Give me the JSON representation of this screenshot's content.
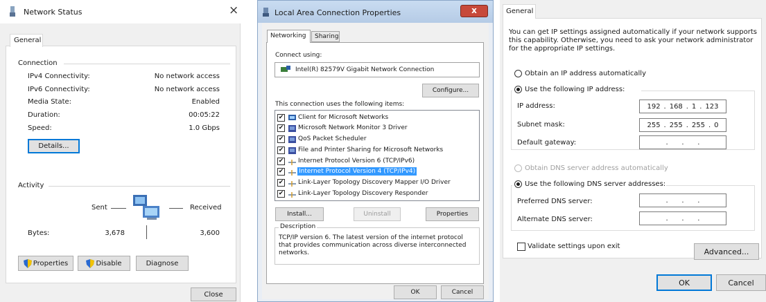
{
  "network_status": {
    "title": "Network Status",
    "close_glyph": "×",
    "tab": "General",
    "connection": {
      "heading": "Connection",
      "rows": [
        {
          "label": "IPv4 Connectivity:",
          "value": "No network access"
        },
        {
          "label": "IPv6 Connectivity:",
          "value": "No network access"
        },
        {
          "label": "Media State:",
          "value": "Enabled"
        },
        {
          "label": "Duration:",
          "value": "00:05:22"
        },
        {
          "label": "Speed:",
          "value": "1.0 Gbps"
        }
      ],
      "details_button": "Details..."
    },
    "activity": {
      "heading": "Activity",
      "sent": "Sent",
      "received": "Received",
      "bytes_label": "Bytes:",
      "bytes_sent": "3,678",
      "bytes_received": "3,600"
    },
    "buttons": {
      "properties": "Properties",
      "disable": "Disable",
      "diagnose": "Diagnose",
      "close": "Close"
    }
  },
  "lac_properties": {
    "title": "Local Area Connection Properties",
    "close_glyph": "x",
    "tabs": [
      "Networking",
      "Sharing"
    ],
    "connect_using_label": "Connect using:",
    "adapter": "Intel(R) 82579V Gigabit Network Connection",
    "configure_button": "Configure...",
    "items_label": "This connection uses the following items:",
    "items": [
      {
        "label": "Client for Microsoft Networks",
        "checked": true,
        "icon": "client-icon"
      },
      {
        "label": "Microsoft Network Monitor 3 Driver",
        "checked": true,
        "icon": "driver-icon"
      },
      {
        "label": "QoS Packet Scheduler",
        "checked": true,
        "icon": "driver-icon"
      },
      {
        "label": "File and Printer Sharing for Microsoft Networks",
        "checked": true,
        "icon": "driver-icon"
      },
      {
        "label": "Internet Protocol Version 6 (TCP/IPv6)",
        "checked": true,
        "icon": "protocol-icon"
      },
      {
        "label": "Internet Protocol Version 4 (TCP/IPv4)",
        "checked": true,
        "icon": "protocol-icon",
        "selected": true
      },
      {
        "label": "Link-Layer Topology Discovery Mapper I/O Driver",
        "checked": true,
        "icon": "protocol-icon"
      },
      {
        "label": "Link-Layer Topology Discovery Responder",
        "checked": true,
        "icon": "protocol-icon"
      }
    ],
    "buttons": {
      "install": "Install...",
      "uninstall": "Uninstall",
      "properties": "Properties",
      "ok": "OK",
      "cancel": "Cancel"
    },
    "description_label": "Description",
    "description_text": "TCP/IP version 6. The latest version of the internet protocol that provides communication across diverse interconnected networks.",
    "check_glyph": "✔"
  },
  "ipv4_properties": {
    "tab": "General",
    "intro": "You can get IP settings assigned automatically if your network supports this capability. Otherwise, you need to ask your network administrator for the appropriate IP settings.",
    "obtain_ip_auto": "Obtain an IP address automatically",
    "use_following_ip": "Use the following IP address:",
    "ip_address_label": "IP address:",
    "ip_address": [
      "192",
      "168",
      "1",
      "123"
    ],
    "subnet_label": "Subnet mask:",
    "subnet": [
      "255",
      "255",
      "255",
      "0"
    ],
    "gateway_label": "Default gateway:",
    "dns_auto": "Obtain DNS server address automatically",
    "dns_manual": "Use the following DNS server addresses:",
    "preferred_dns_label": "Preferred DNS server:",
    "alternate_dns_label": "Alternate DNS server:",
    "empty_dot": ".",
    "validate_label": "Validate settings upon exit",
    "advanced_button": "Advanced...",
    "ok_button": "OK",
    "cancel_button": "Cancel"
  },
  "colors": {
    "selection": "#3399ff",
    "accent": "#0078d7"
  }
}
